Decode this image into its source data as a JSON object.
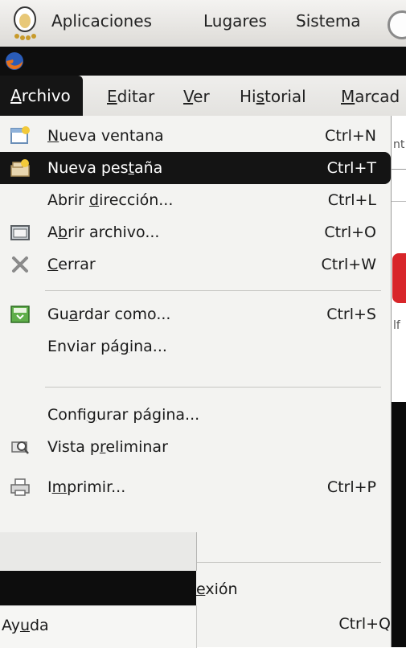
{
  "panel": {
    "items": [
      "Aplicaciones",
      "Lugares",
      "Sistema"
    ],
    "icons": [
      "gnome-foot-icon",
      "system-settings-icon"
    ]
  },
  "firefox_logo": "firefox-icon",
  "menubar": {
    "menus": [
      {
        "label": "Archivo",
        "mnemonic": "A",
        "active": true
      },
      {
        "label": "Editar",
        "mnemonic": "E"
      },
      {
        "label": "Ver",
        "mnemonic": "V"
      },
      {
        "label": "Historial",
        "mnemonic": "s"
      },
      {
        "label": "Marcad",
        "mnemonic": "M"
      }
    ]
  },
  "dropdown": {
    "items": [
      {
        "pre": "",
        "u": "N",
        "post": "ueva ventana",
        "accel": "Ctrl+N",
        "icon": "new-window-icon"
      },
      {
        "pre": "Nueva pes",
        "u": "t",
        "post": "aña",
        "accel": "Ctrl+T",
        "icon": "new-tab-icon",
        "highlight": true
      },
      {
        "pre": "Abrir ",
        "u": "d",
        "post": "irección...",
        "accel": "Ctrl+L",
        "icon": ""
      },
      {
        "pre": "A",
        "u": "b",
        "post": "rir archivo...",
        "accel": "Ctrl+O",
        "icon": "open-file-icon"
      },
      {
        "pre": "",
        "u": "C",
        "post": "errar",
        "accel": "Ctrl+W",
        "icon": "close-icon"
      },
      {
        "pre": "Gu",
        "u": "a",
        "post": "rdar como...",
        "accel": "Ctrl+S",
        "icon": "save-as-icon"
      },
      {
        "pre": "Enviar pá",
        "u": "g",
        "post": "ina...",
        "accel": "",
        "icon": ""
      },
      {
        "pre": "Confi",
        "u": "g",
        "post": "urar página...",
        "accel": "",
        "icon": ""
      },
      {
        "pre": "Vista p",
        "u": "r",
        "post": "eliminar",
        "accel": "",
        "icon": "print-preview-icon"
      },
      {
        "pre": "I",
        "u": "m",
        "post": "primir...",
        "accel": "Ctrl+P",
        "icon": "print-icon"
      }
    ],
    "partial_item": {
      "pre": "",
      "u": "e",
      "post": "xión"
    },
    "quit_accel": "Ctrl+Q"
  },
  "overlay_window": {
    "pre": "Ay",
    "u": "u",
    "post": "da"
  },
  "background_fragments": [
    "nt",
    "lf"
  ],
  "colors": {
    "highlight": "#141414",
    "menu_bg": "#f3f3f1",
    "panel_bg": "#e8e7e4"
  }
}
